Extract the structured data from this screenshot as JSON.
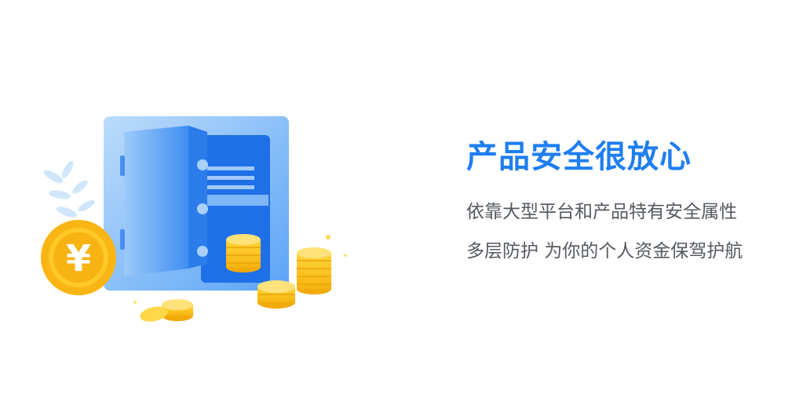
{
  "headline": "产品安全很放心",
  "description": {
    "line1": "依靠大型平台和产品特有安全属性",
    "line2": "多层防护 为你的个人资金保驾护航"
  },
  "illustration": {
    "coin_symbol": "¥"
  },
  "colors": {
    "headline": "#1e7ef0",
    "body_text": "#555a60",
    "safe_blue": "#4a97f5",
    "coin_gold": "#fcc21b"
  }
}
